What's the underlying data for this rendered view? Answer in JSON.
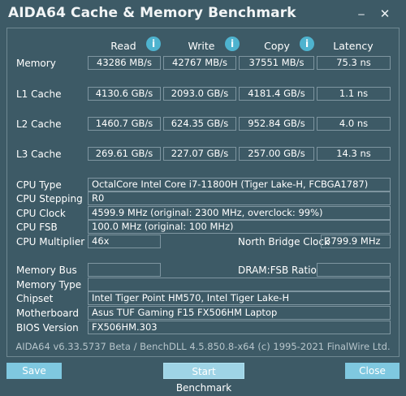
{
  "window": {
    "title": "AIDA64 Cache & Memory Benchmark",
    "icons": [
      "close-icon",
      "minimize-icon"
    ]
  },
  "columns": {
    "read": "Read",
    "write": "Write",
    "copy": "Copy",
    "latency": "Latency",
    "info_glyph": "i"
  },
  "rows": [
    {
      "label": "Memory",
      "read": "43286 MB/s",
      "write": "42767 MB/s",
      "copy": "37551 MB/s",
      "latency": "75.3 ns"
    },
    {
      "label": "L1 Cache",
      "read": "4130.6 GB/s",
      "write": "2093.0 GB/s",
      "copy": "4181.4 GB/s",
      "latency": "1.1 ns"
    },
    {
      "label": "L2 Cache",
      "read": "1460.7 GB/s",
      "write": "624.35 GB/s",
      "copy": "952.84 GB/s",
      "latency": "4.0 ns"
    },
    {
      "label": "L3 Cache",
      "read": "269.61 GB/s",
      "write": "227.07 GB/s",
      "copy": "257.00 GB/s",
      "latency": "14.3 ns"
    }
  ],
  "cpu": {
    "type_label": "CPU Type",
    "type_value": "OctalCore Intel Core i7-11800H  (Tiger Lake-H, FCBGA1787)",
    "stepping_label": "CPU Stepping",
    "stepping_value": "R0",
    "clock_label": "CPU Clock",
    "clock_value": "4599.9 MHz  (original: 2300 MHz, overclock: 99%)",
    "fsb_label": "CPU FSB",
    "fsb_value": "100.0 MHz  (original: 100 MHz)",
    "multiplier_label": "CPU Multiplier",
    "multiplier_value": "46x",
    "nb_clock_label": "North Bridge Clock",
    "nb_clock_value": "3799.9 MHz"
  },
  "memory": {
    "bus_label": "Memory Bus",
    "bus_value": "",
    "dram_ratio_label": "DRAM:FSB Ratio",
    "dram_ratio_value": "",
    "type_label": "Memory Type",
    "type_value": ""
  },
  "system": {
    "chipset_label": "Chipset",
    "chipset_value": "Intel Tiger Point HM570, Intel Tiger Lake-H",
    "motherboard_label": "Motherboard",
    "motherboard_value": "Asus TUF Gaming F15 FX506HM Laptop",
    "bios_label": "BIOS Version",
    "bios_value": "FX506HM.303"
  },
  "footer": {
    "text": "AIDA64 v6.33.5737 Beta / BenchDLL 4.5.850.8-x64  (c) 1995-2021 FinalWire Ltd."
  },
  "buttons": {
    "save": "Save",
    "start": "Start Benchmark",
    "close": "Close"
  }
}
